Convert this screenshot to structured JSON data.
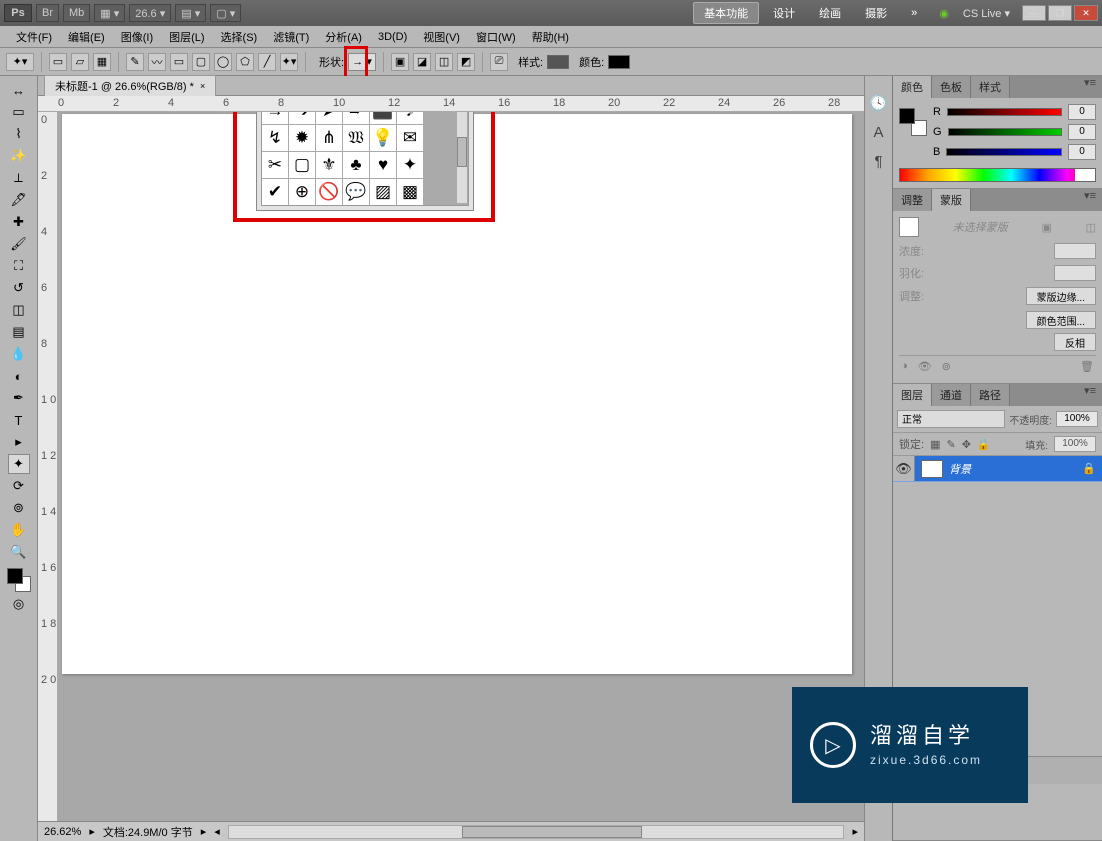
{
  "titlebar": {
    "logo": "Ps",
    "btn_br": "Br",
    "btn_mb": "Mb",
    "zoom_mode": "▦ ▾",
    "zoom_val": "26.6 ▾",
    "view1": "▤ ▾",
    "view2": "▢ ▾",
    "workspace_basic": "基本功能",
    "workspace_design": "设计",
    "workspace_paint": "绘画",
    "workspace_photo": "摄影",
    "more": "»",
    "cslive": "CS Live ▾"
  },
  "menus": [
    "文件(F)",
    "编辑(E)",
    "图像(I)",
    "图层(L)",
    "选择(S)",
    "滤镜(T)",
    "分析(A)",
    "3D(D)",
    "视图(V)",
    "窗口(W)",
    "帮助(H)"
  ],
  "optbar": {
    "shape_label": "形状:",
    "style_label": "样式:",
    "color_label": "颜色:"
  },
  "doc_tab": "未标题-1 @ 26.6%(RGB/8) *",
  "ruler_h": [
    "0",
    "2",
    "4",
    "6",
    "8",
    "10",
    "12",
    "14",
    "16",
    "18",
    "20",
    "22",
    "24",
    "26",
    "28"
  ],
  "ruler_v": [
    "0",
    "2",
    "4",
    "6",
    "8",
    "1\n0",
    "1\n2",
    "1\n4",
    "1\n6",
    "1\n8",
    "2\n0"
  ],
  "status": {
    "zoom": "26.62%",
    "doc": "文档:24.9M/0 字节"
  },
  "shapes_grid": [
    "→",
    "➔",
    "➤",
    "➨",
    "⬛",
    "♪",
    "↯",
    "✹",
    "⋔",
    "𝔚",
    "💡",
    "✉",
    "✂",
    "▢",
    "⚜",
    "♣",
    "♥",
    "✦",
    "✔",
    "⊕",
    "🚫",
    "💬",
    "▨",
    "▩"
  ],
  "panels": {
    "color_tabs": [
      "颜色",
      "色板",
      "样式"
    ],
    "rgb": {
      "R": "0",
      "G": "0",
      "B": "0"
    },
    "adjust_tab": "调整",
    "mask_tab": "蒙版",
    "mask_none": "未选择蒙版",
    "mask_density": "浓度:",
    "mask_feather": "羽化:",
    "mask_adjust": "调整:",
    "mask_edge": "蒙版边缘...",
    "mask_colorrange": "颜色范围...",
    "mask_invert": "反相",
    "layers_tabs": [
      "图层",
      "通道",
      "路径"
    ],
    "blend_mode": "正常",
    "opacity_label": "不透明度:",
    "opacity_val": "100%",
    "lock_label": "锁定:",
    "fill_label": "填充:",
    "fill_val": "100%",
    "layer_name": "背景"
  },
  "watermark": {
    "title": "溜溜自学",
    "sub": "zixue.3d66.com"
  }
}
